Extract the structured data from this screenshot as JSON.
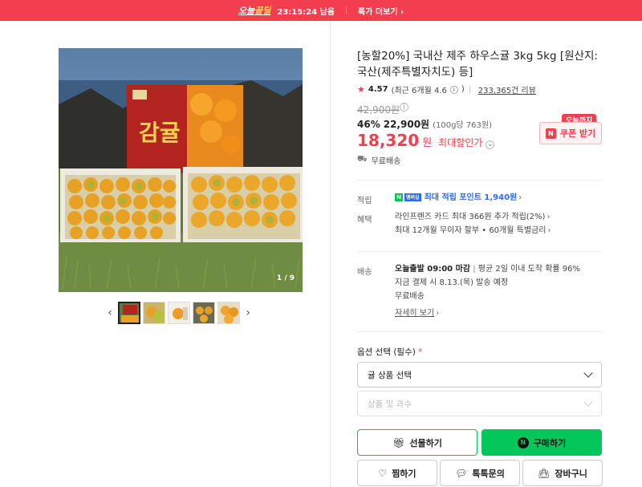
{
  "promo_bar": {
    "brand_prefix": "오늘",
    "brand_highlight": "끝딜",
    "time_left": "23:15:24 남음",
    "more_label": "특가 더보기",
    "background": "#f23e4f"
  },
  "gallery": {
    "counter": "1 / 9",
    "prev_icon": "chevron-left-icon",
    "next_icon": "chevron-right-icon",
    "thumb_count": 5,
    "selected_index": 0
  },
  "product": {
    "title": "[농할20%] 국내산 제주 하우스귤 3kg 5kg [원산지: 국산(제주특별자치도) 등]",
    "rating": "4.57",
    "recent_rating": "(최근 6개월 4.6",
    "review_count": "233,365건 리뷰",
    "original_price": "42,900원",
    "discount": "46%",
    "discount_price": "22,900원",
    "unit_price": "(100g당 763원)",
    "final_price": "18,320",
    "final_won": "원",
    "max_discount_label": "최대할인가",
    "shipping": "무료배송"
  },
  "coupon": {
    "tag": "오늘까지",
    "label": "쿠폰 받기"
  },
  "benefits": {
    "points_label": "적립",
    "points_value": "최대 적립 포인트 1,940원",
    "benefit_label": "혜택",
    "benefit_line1": "라인프렌즈 카드 최대 366원 추가 적립(2%)",
    "benefit_line2": "최대 12개월 무이자 할부 • 60개월 특별금리"
  },
  "delivery": {
    "label": "배송",
    "dispatch": "오늘출발 09:00 마감",
    "average": "평균 2일 이내 도착 확률 96%",
    "eta": "지금 결제 시 8.13.(목) 발송 예정",
    "fee": "무료배송",
    "detail_link": "자세히 보기"
  },
  "options": {
    "label": "옵션 선택 (필수)",
    "required_mark": "*",
    "select1": "귤 상품 선택",
    "select2": "상품 및 과수"
  },
  "actions": {
    "gift": "선물하기",
    "buy": "구매하기",
    "wish": "찜하기",
    "talk": "톡톡문의",
    "cart": "장바구니"
  },
  "colors": {
    "accent_red": "#f23e4f",
    "naver_green": "#03c75a",
    "point_blue": "#2d6bf0"
  }
}
